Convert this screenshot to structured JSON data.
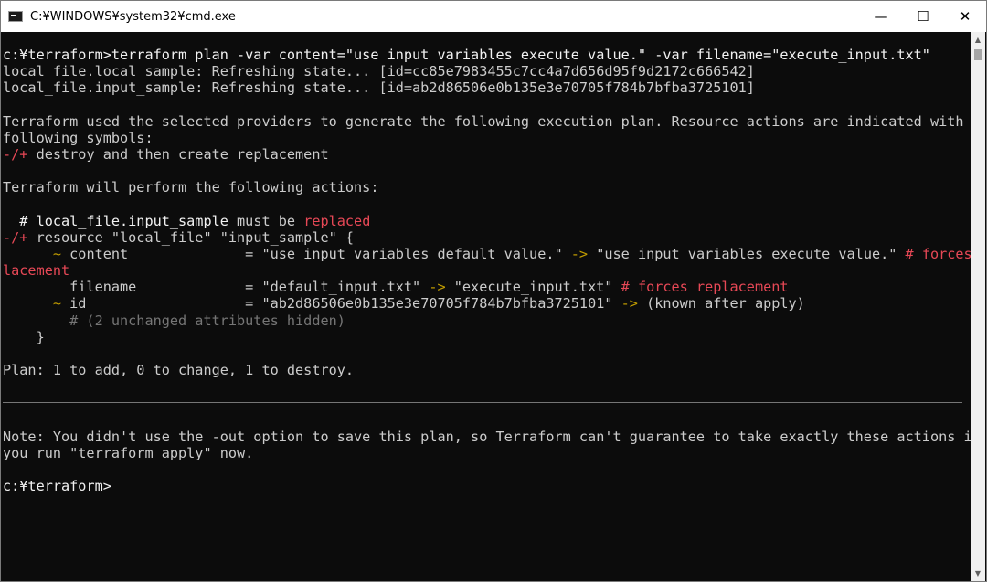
{
  "window": {
    "title": "C:¥WINDOWS¥system32¥cmd.exe"
  },
  "controls": {
    "minimize": "—",
    "maximize": "☐",
    "close": "✕"
  },
  "terminal": {
    "l1": "c:¥terraform>terraform plan -var content=\"use input variables execute value.\" -var filename=\"execute_input.txt\"",
    "l2": "local_file.local_sample: Refreshing state... [id=cc85e7983455c7cc4a7d656d95f9d2172c666542]",
    "l3": "local_file.input_sample: Refreshing state... [id=ab2d86506e0b135e3e70705f784b7bfba3725101]",
    "l5": "Terraform used the selected providers to generate the following execution plan. Resource actions are indicated with the",
    "l6": "following symbols:",
    "l7_sym": "-/+",
    "l7_text": " destroy and then create replacement",
    "l9": "Terraform will perform the following actions:",
    "l11_a": "  # local_file.input_sample",
    "l11_b": " must be ",
    "l11_c": "replaced",
    "l12_sym": "-/+",
    "l12_text": " resource \"local_file\" \"input_sample\" {",
    "l13_sym": "      ~",
    "l13_text": " content              = \"use input variables default value.\" ",
    "l13_arrow": "->",
    "l13_text2": " \"use input variables execute value.\" ",
    "l13_note": "# forces rep",
    "l14": "lacement",
    "l15_text": "        filename             = \"default_input.txt\" ",
    "l15_arrow": "->",
    "l15_text2": " \"execute_input.txt\" ",
    "l15_note": "# forces replacement",
    "l16_sym": "      ~",
    "l16_text": " id                   = \"ab2d86506e0b135e3e70705f784b7bfba3725101\" ",
    "l16_arrow": "->",
    "l16_text2": " (known after apply)",
    "l17": "        # (2 unchanged attributes hidden)",
    "l18": "    }",
    "l20": "Plan: 1 to add, 0 to change, 1 to destroy.",
    "l24": "Note: You didn't use the -out option to save this plan, so Terraform can't guarantee to take exactly these actions if",
    "l25": "you run \"terraform apply\" now.",
    "l27": "c:¥terraform>"
  },
  "colors": {
    "background": "#0c0c0c",
    "text": "#cccccc",
    "red": "#e74856",
    "green": "#16c60c",
    "yellow": "#c19c00",
    "gray": "#767676"
  }
}
